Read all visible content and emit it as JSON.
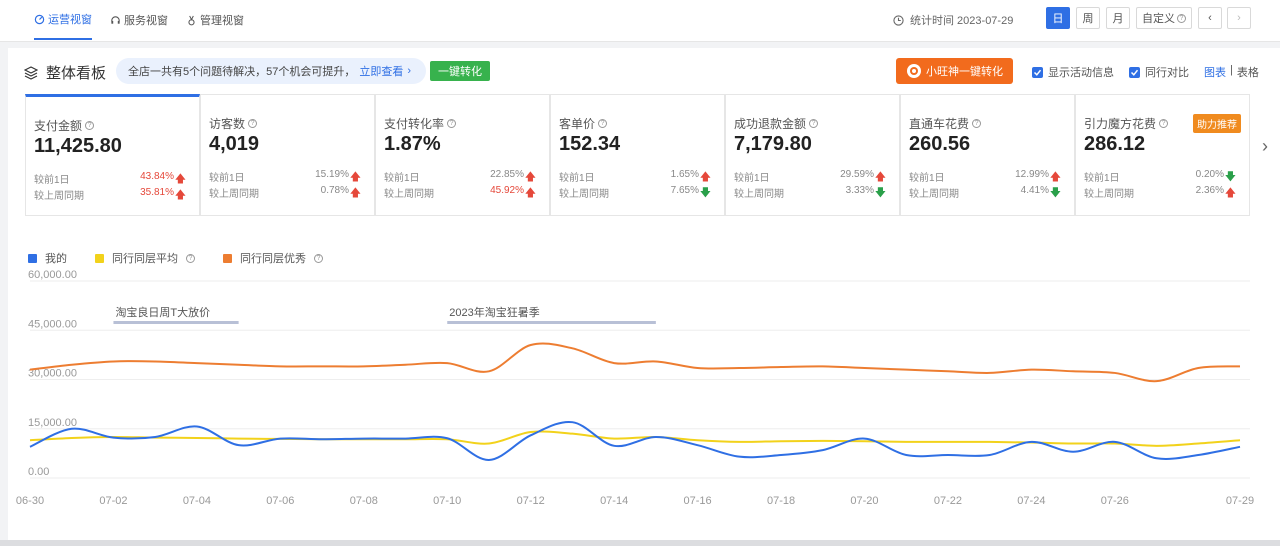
{
  "nav": {
    "views": [
      {
        "label": "运营视窗",
        "active": true,
        "icon": "dashboard-icon"
      },
      {
        "label": "服务视窗",
        "active": false,
        "icon": "headset-icon"
      },
      {
        "label": "管理视窗",
        "active": false,
        "icon": "medal-icon"
      }
    ],
    "stat_time_label": "统计时间 2023-07-29",
    "periods": [
      "日",
      "周",
      "月",
      "自定义"
    ],
    "active_period": "日",
    "prev_icon": "chevron-left-icon",
    "next_icon": "chevron-right-icon"
  },
  "toolbar": {
    "title": "整体看板",
    "notice_text": "全店一共有5个问题待解决，57个机会可提升，",
    "notice_link": "立即查看",
    "convert_button": "一键转化",
    "wangwang_button": "小旺神一键转化",
    "show_activity": "显示活动信息",
    "peer_compare": "同行对比",
    "view_chart": "图表",
    "view_table": "表格"
  },
  "metrics": [
    {
      "label": "支付金额",
      "value": "11,425.80",
      "d1_label": "较前1日",
      "d1": "43.84%",
      "d1_dir": "up",
      "w_label": "较上周同期",
      "w": "35.81%",
      "w_dir": "up",
      "d1_red": true,
      "w_red": true,
      "active": true
    },
    {
      "label": "访客数",
      "value": "4,019",
      "d1_label": "较前1日",
      "d1": "15.19%",
      "d1_dir": "up",
      "w_label": "较上周同期",
      "w": "0.78%",
      "w_dir": "up",
      "d1_red": false,
      "w_red": false
    },
    {
      "label": "支付转化率",
      "value": "1.87%",
      "d1_label": "较前1日",
      "d1": "22.85%",
      "d1_dir": "up",
      "w_label": "较上周同期",
      "w": "45.92%",
      "w_dir": "up",
      "d1_red": false,
      "w_red": true
    },
    {
      "label": "客单价",
      "value": "152.34",
      "d1_label": "较前1日",
      "d1": "1.65%",
      "d1_dir": "up",
      "w_label": "较上周同期",
      "w": "7.65%",
      "w_dir": "down",
      "d1_red": false,
      "w_red": false
    },
    {
      "label": "成功退款金额",
      "value": "7,179.80",
      "d1_label": "较前1日",
      "d1": "29.59%",
      "d1_dir": "up",
      "w_label": "较上周同期",
      "w": "3.33%",
      "w_dir": "down",
      "d1_red": false,
      "w_red": false
    },
    {
      "label": "直通车花费",
      "value": "260.56",
      "d1_label": "较前1日",
      "d1": "12.99%",
      "d1_dir": "up",
      "w_label": "较上周同期",
      "w": "4.41%",
      "w_dir": "down",
      "d1_red": false,
      "w_red": false
    },
    {
      "label": "引力魔方花费",
      "value": "286.12",
      "d1_label": "较前1日",
      "d1": "0.20%",
      "d1_dir": "down",
      "w_label": "较上周同期",
      "w": "2.36%",
      "w_dir": "up",
      "d1_red": false,
      "w_red": false,
      "badge": "助力推荐"
    }
  ],
  "chart_data": {
    "type": "line",
    "x": [
      "06-30",
      "07-01",
      "07-02",
      "07-03",
      "07-04",
      "07-05",
      "07-06",
      "07-07",
      "07-08",
      "07-09",
      "07-10",
      "07-11",
      "07-12",
      "07-13",
      "07-14",
      "07-15",
      "07-16",
      "07-17",
      "07-18",
      "07-19",
      "07-20",
      "07-21",
      "07-22",
      "07-23",
      "07-24",
      "07-25",
      "07-26",
      "07-27",
      "07-28",
      "07-29"
    ],
    "x_ticks": [
      "06-30",
      "07-02",
      "07-04",
      "07-06",
      "07-08",
      "07-10",
      "07-12",
      "07-14",
      "07-16",
      "07-18",
      "07-20",
      "07-22",
      "07-24",
      "07-26",
      "07-29"
    ],
    "y_ticks": [
      "60,000.00",
      "45,000.00",
      "30,000.00",
      "15,000.00",
      "0.00"
    ],
    "ylim": [
      0,
      60000
    ],
    "series": [
      {
        "name": "我的",
        "color": "#2f6fe4",
        "values": [
          9500,
          15000,
          12300,
          12500,
          15700,
          10000,
          12000,
          11800,
          12000,
          12000,
          12100,
          5500,
          13000,
          17000,
          9800,
          12500,
          10000,
          6500,
          7000,
          8500,
          12000,
          7000,
          7000,
          7000,
          11000,
          8000,
          11000,
          6000,
          7000,
          9500
        ]
      },
      {
        "name": "同行同层平均",
        "color": "#f2d21b",
        "values": [
          11500,
          12200,
          12500,
          12300,
          12200,
          12000,
          11900,
          11800,
          11800,
          11800,
          11800,
          10500,
          14000,
          13500,
          12000,
          12500,
          11500,
          11000,
          11200,
          11300,
          11200,
          11000,
          11000,
          11000,
          10800,
          10500,
          10500,
          9800,
          10500,
          11500
        ]
      },
      {
        "name": "同行同层优秀",
        "color": "#ed7d31",
        "values": [
          33000,
          34500,
          35500,
          35500,
          35000,
          34500,
          34000,
          34000,
          34000,
          34500,
          35000,
          32500,
          40500,
          39500,
          35000,
          35500,
          33500,
          33500,
          33800,
          34000,
          33500,
          33000,
          32500,
          32000,
          33000,
          32500,
          32000,
          29500,
          33500,
          34000
        ]
      }
    ],
    "annotations": [
      {
        "label": "淘宝良日周T大放价",
        "from": "07-02",
        "to": "07-05"
      },
      {
        "label": "2023年淘宝狂暑季",
        "from": "07-10",
        "to": "07-15"
      }
    ],
    "legend_position": "top-left",
    "grid": true
  }
}
